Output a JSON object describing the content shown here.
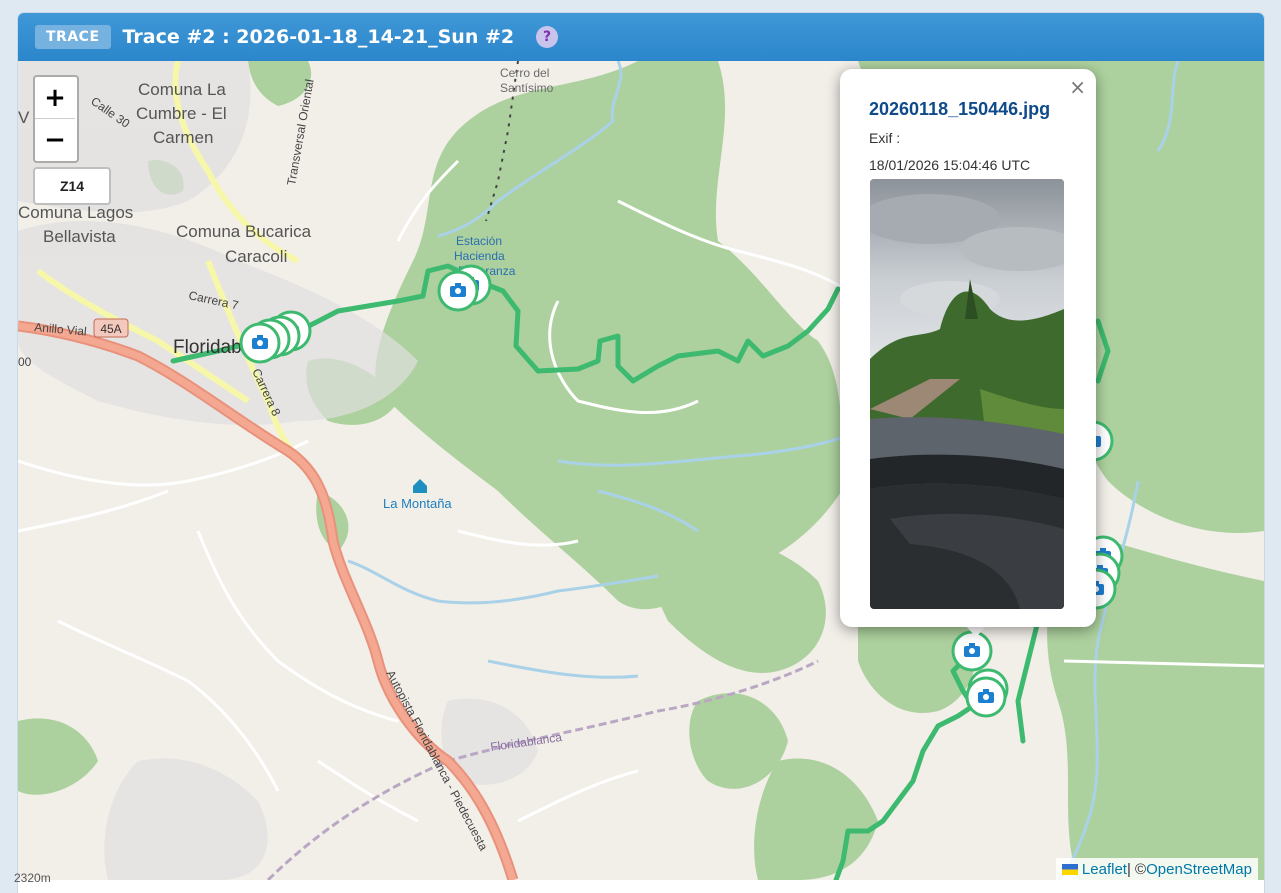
{
  "header": {
    "badge": "TRACE",
    "title": "Trace #2 : 2026-01-18_14-21_Sun #2",
    "help_icon": "?"
  },
  "controls": {
    "zoom_in": "+",
    "zoom_out": "−",
    "zoom_level": "Z14"
  },
  "popup": {
    "close": "×",
    "filename": "20260118_150446.jpg",
    "exif_label": "Exif :",
    "datetime": "18/01/2026 15:04:46 UTC"
  },
  "map": {
    "labels": {
      "comuna_la_cumbre": [
        "Comuna La",
        "Cumbre - El",
        "Carmen"
      ],
      "comuna_lagos": [
        "Comuna Lagos",
        "Bellavista"
      ],
      "comuna_bucarica": [
        "Comuna Bucarica",
        "Caracoli"
      ],
      "cerro": [
        "Cerro del",
        "Santísimo"
      ],
      "estacion": [
        "Estación",
        "Hacienda",
        "Esperanza"
      ],
      "floridablanca_town": "Floridablanca",
      "floridablanca_area": "Floridablanca",
      "la_montana": "La Montaña",
      "carrera7": "Carrera 7",
      "carrera8": "Carrera 8",
      "calle30": "Calle 30",
      "anillo_vial": "Anillo Vial",
      "route_45a": "45A",
      "transversal": "Transversal Oriental",
      "autopista": "Autopista Floridablanca - Piedecuesta",
      "edge_v": "V",
      "edge_00": "00"
    },
    "colors": {
      "land": "#f2efe9",
      "forest": "#add19e",
      "track": "#3dba6f",
      "motorway": "#e8917b",
      "primary": "#f6f7a8",
      "water": "#a9d1e8",
      "marker_icon": "#1d7fcf"
    }
  },
  "attribution": {
    "leaflet": "Leaflet",
    "separator": " | © ",
    "osm": "OpenStreetMap"
  },
  "scale": "2320m"
}
